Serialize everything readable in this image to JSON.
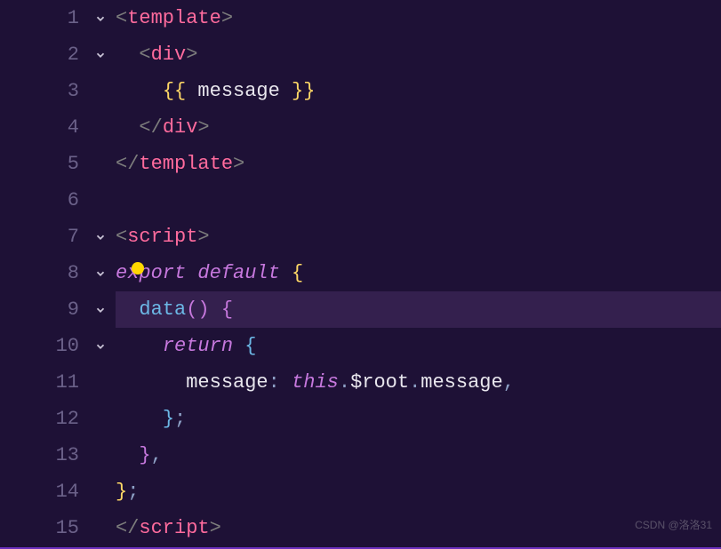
{
  "watermark": "CSDN @洛洛31",
  "lines": [
    {
      "num": "1",
      "fold": true,
      "tokens": [
        [
          "c-bracket",
          "<"
        ],
        [
          "c-tag",
          "template"
        ],
        [
          "c-bracket",
          ">"
        ]
      ]
    },
    {
      "num": "2",
      "fold": true,
      "tokens": [
        [
          "",
          "  "
        ],
        [
          "c-bracket",
          "<"
        ],
        [
          "c-tag",
          "div"
        ],
        [
          "c-bracket",
          ">"
        ]
      ]
    },
    {
      "num": "3",
      "fold": false,
      "tokens": [
        [
          "",
          "    "
        ],
        [
          "c-mustache",
          "{{"
        ],
        [
          "c-white",
          " message "
        ],
        [
          "c-mustache",
          "}}"
        ]
      ]
    },
    {
      "num": "4",
      "fold": false,
      "tokens": [
        [
          "",
          "  "
        ],
        [
          "c-bracket",
          "</"
        ],
        [
          "c-tag",
          "div"
        ],
        [
          "c-bracket",
          ">"
        ]
      ]
    },
    {
      "num": "5",
      "fold": false,
      "tokens": [
        [
          "c-bracket",
          "</"
        ],
        [
          "c-tag",
          "template"
        ],
        [
          "c-bracket",
          ">"
        ]
      ]
    },
    {
      "num": "6",
      "fold": false,
      "tokens": []
    },
    {
      "num": "7",
      "fold": true,
      "tokens": [
        [
          "c-bracket",
          "<"
        ],
        [
          "c-tag",
          "script"
        ],
        [
          "c-bracket",
          ">"
        ]
      ]
    },
    {
      "num": "8",
      "fold": true,
      "tokens": [
        [
          "c-kw",
          "export"
        ],
        [
          "c-white",
          " "
        ],
        [
          "c-kw2",
          "default"
        ],
        [
          "c-white",
          " "
        ],
        [
          "c-brace",
          "{"
        ]
      ]
    },
    {
      "num": "9",
      "fold": true,
      "hl": true,
      "tokens": [
        [
          "",
          "  "
        ],
        [
          "c-fn",
          "data"
        ],
        [
          "c-brace2",
          "()"
        ],
        [
          "c-white",
          " "
        ],
        [
          "c-brace2",
          "{"
        ]
      ]
    },
    {
      "num": "10",
      "fold": true,
      "tokens": [
        [
          "",
          "    "
        ],
        [
          "c-kw",
          "return"
        ],
        [
          "c-white",
          " "
        ],
        [
          "c-brace3",
          "{"
        ]
      ]
    },
    {
      "num": "11",
      "fold": false,
      "tokens": [
        [
          "",
          "      "
        ],
        [
          "c-prop",
          "message"
        ],
        [
          "c-punct",
          ":"
        ],
        [
          "c-white",
          " "
        ],
        [
          "c-this",
          "this"
        ],
        [
          "c-punct",
          "."
        ],
        [
          "c-var",
          "$root"
        ],
        [
          "c-punct",
          "."
        ],
        [
          "c-var",
          "message"
        ],
        [
          "c-punct",
          ","
        ]
      ]
    },
    {
      "num": "12",
      "fold": false,
      "tokens": [
        [
          "",
          "    "
        ],
        [
          "c-brace3",
          "}"
        ],
        [
          "c-punct",
          ";"
        ]
      ]
    },
    {
      "num": "13",
      "fold": false,
      "tokens": [
        [
          "",
          "  "
        ],
        [
          "c-brace2",
          "}"
        ],
        [
          "c-punct",
          ","
        ]
      ]
    },
    {
      "num": "14",
      "fold": false,
      "tokens": [
        [
          "c-brace",
          "}"
        ],
        [
          "c-punct",
          ";"
        ]
      ]
    },
    {
      "num": "15",
      "fold": false,
      "tokens": [
        [
          "c-bracket",
          "</"
        ],
        [
          "c-tag",
          "script"
        ],
        [
          "c-bracket",
          ">"
        ]
      ]
    }
  ]
}
